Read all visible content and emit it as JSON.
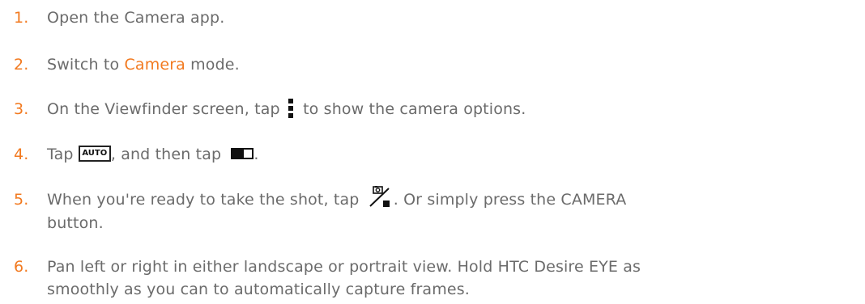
{
  "steps": [
    {
      "number": "1.",
      "text": "Open the Camera app."
    },
    {
      "number": "2.",
      "before": "Switch to ",
      "emphasis": "Camera",
      "after": " mode."
    },
    {
      "number": "3.",
      "before": "On the Viewfinder screen, tap ",
      "icon": "more-options-icon",
      "after": " to show the camera options."
    },
    {
      "number": "4.",
      "before": "Tap ",
      "icon1": "auto-mode-icon",
      "icon1_label": "AUTO",
      "middle": ", and then tap ",
      "icon2": "panorama-mode-icon",
      "after": "."
    },
    {
      "number": "5.",
      "before": "When you're ready to take the shot, tap ",
      "icon": "shutter-icon",
      "after": ". Or simply press the CAMERA",
      "line2": "button."
    },
    {
      "number": "6.",
      "line1": "Pan left or right in either landscape or portrait view. Hold HTC Desire EYE as",
      "line2": "smoothly as you can to automatically capture frames."
    }
  ],
  "colors": {
    "text": "#6b6b6b",
    "accent": "#f27a20",
    "icon": "#111111"
  }
}
